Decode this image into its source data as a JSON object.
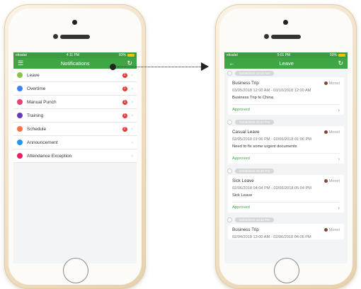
{
  "left_screen": {
    "status": {
      "carrier": "etisalat",
      "time": "4:11 PM",
      "battery": "83%"
    },
    "appbar": {
      "title": "Notifications"
    },
    "items": [
      {
        "label": "Leave",
        "color": "#8bc34a",
        "badge": "2"
      },
      {
        "label": "Overtime",
        "color": "#3b82f6",
        "badge": "1"
      },
      {
        "label": "Manual Punch",
        "color": "#ec407a",
        "badge": "1"
      },
      {
        "label": "Training",
        "color": "#673ab7",
        "badge": "1"
      },
      {
        "label": "Schedule",
        "color": "#ff7043",
        "badge": "2"
      },
      {
        "label": "Announcement",
        "color": "#2196f3",
        "badge": ""
      },
      {
        "label": "Attendance Exception",
        "color": "#e91e63",
        "badge": ""
      }
    ]
  },
  "right_screen": {
    "status": {
      "carrier": "etisalat",
      "time": "5:01 PM",
      "battery": "50%"
    },
    "appbar": {
      "title": "Leave"
    },
    "cards": [
      {
        "date_pill": "03/05/2018 10:12 AM",
        "type": "Business Trip",
        "user": "Monet",
        "range": "03/05/2018 12:00 AM - 03/10/2018 12:00 AM",
        "reason": "Business Trip to China",
        "status": "Approved"
      },
      {
        "date_pill": "02/05/2018 05:27 PM",
        "type": "Casual Leave",
        "user": "Monet",
        "range": "02/05/2018 01:06 PM - 02/06/2018 01:06 PM",
        "reason": "Need to fix some urgent documents",
        "status": "Approved"
      },
      {
        "date_pill": "02/05/2018 05:25 PM",
        "type": "Sick Leave",
        "user": "Monet",
        "range": "02/06/2018 04:04 PM - 02/06/2018 05:04 PM",
        "reason": "Sick Leave",
        "status": "Approved"
      },
      {
        "date_pill": "02/04/2018 04:11 PM",
        "type": "Business Trip",
        "user": "Monet",
        "range": "02/04/2018 12:00 AM - 02/06/2018 04:06 PM",
        "reason": "",
        "status": ""
      }
    ]
  }
}
